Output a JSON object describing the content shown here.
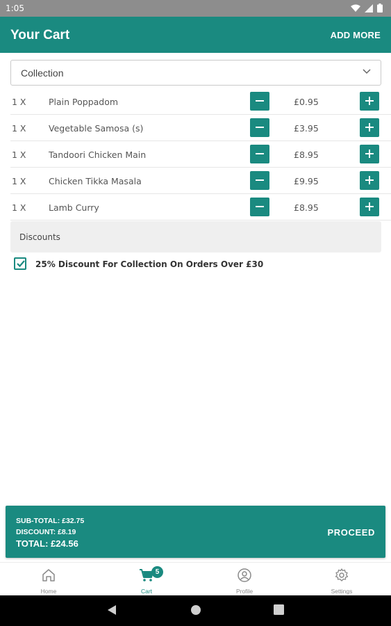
{
  "status_bar": {
    "time": "1:05"
  },
  "app_bar": {
    "title": "Your Cart",
    "action": "ADD MORE"
  },
  "order_type": {
    "selected": "Collection"
  },
  "cart": {
    "items": [
      {
        "qty": "1 X",
        "name": "Plain Poppadom",
        "price": "£0.95"
      },
      {
        "qty": "1 X",
        "name": "Vegetable Samosa (s)",
        "price": "£3.95"
      },
      {
        "qty": "1 X",
        "name": "Tandoori Chicken Main",
        "price": "£8.95"
      },
      {
        "qty": "1 X",
        "name": "Chicken Tikka Masala",
        "price": "£9.95"
      },
      {
        "qty": "1 X",
        "name": "Lamb Curry",
        "price": "£8.95"
      }
    ]
  },
  "discounts": {
    "title": "Discounts",
    "option": {
      "label": "25% Discount For Collection On Orders Over £30",
      "checked": true
    }
  },
  "totals": {
    "subtotal": "SUB-TOTAL: £32.75",
    "discount": "DISCOUNT: £8.19",
    "total": "TOTAL: £24.56",
    "proceed": "PROCEED"
  },
  "bottom_nav": {
    "items": [
      {
        "label": "Home",
        "icon": "home-icon"
      },
      {
        "label": "Cart",
        "icon": "cart-icon",
        "badge": "5",
        "active": true
      },
      {
        "label": "Profile",
        "icon": "profile-icon"
      },
      {
        "label": "Settings",
        "icon": "gear-icon"
      }
    ]
  },
  "colors": {
    "primary": "#1a8a80",
    "status_bar": "#8d8d8d",
    "panel": "#efefef"
  }
}
